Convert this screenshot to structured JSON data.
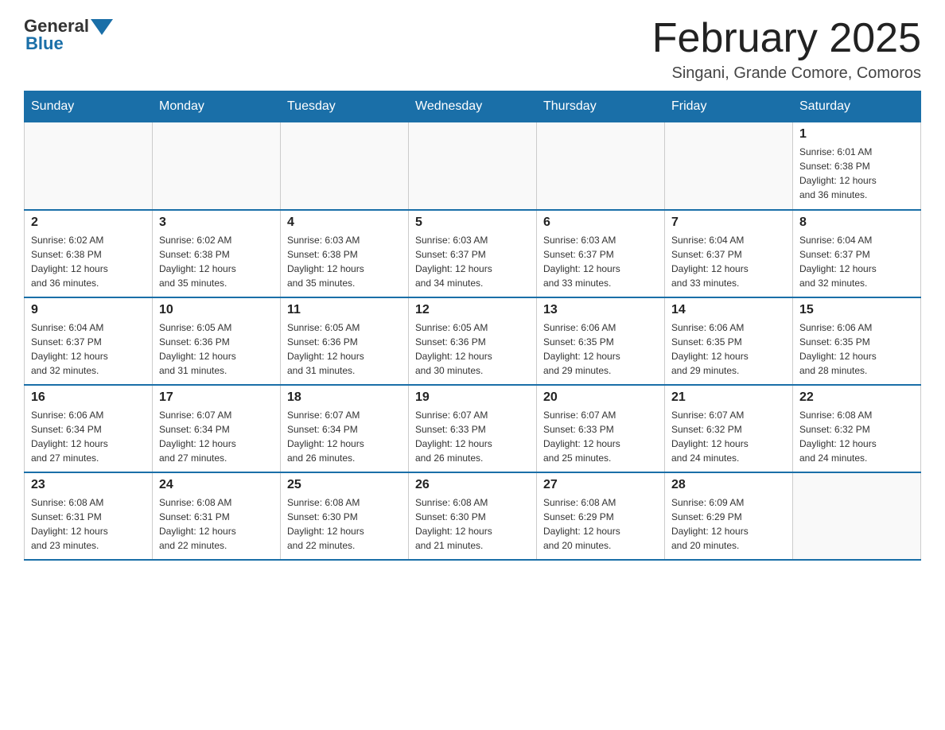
{
  "header": {
    "logo_general": "General",
    "logo_blue": "Blue",
    "title": "February 2025",
    "subtitle": "Singani, Grande Comore, Comoros"
  },
  "weekdays": [
    "Sunday",
    "Monday",
    "Tuesday",
    "Wednesday",
    "Thursday",
    "Friday",
    "Saturday"
  ],
  "weeks": [
    [
      {
        "day": "",
        "info": ""
      },
      {
        "day": "",
        "info": ""
      },
      {
        "day": "",
        "info": ""
      },
      {
        "day": "",
        "info": ""
      },
      {
        "day": "",
        "info": ""
      },
      {
        "day": "",
        "info": ""
      },
      {
        "day": "1",
        "info": "Sunrise: 6:01 AM\nSunset: 6:38 PM\nDaylight: 12 hours\nand 36 minutes."
      }
    ],
    [
      {
        "day": "2",
        "info": "Sunrise: 6:02 AM\nSunset: 6:38 PM\nDaylight: 12 hours\nand 36 minutes."
      },
      {
        "day": "3",
        "info": "Sunrise: 6:02 AM\nSunset: 6:38 PM\nDaylight: 12 hours\nand 35 minutes."
      },
      {
        "day": "4",
        "info": "Sunrise: 6:03 AM\nSunset: 6:38 PM\nDaylight: 12 hours\nand 35 minutes."
      },
      {
        "day": "5",
        "info": "Sunrise: 6:03 AM\nSunset: 6:37 PM\nDaylight: 12 hours\nand 34 minutes."
      },
      {
        "day": "6",
        "info": "Sunrise: 6:03 AM\nSunset: 6:37 PM\nDaylight: 12 hours\nand 33 minutes."
      },
      {
        "day": "7",
        "info": "Sunrise: 6:04 AM\nSunset: 6:37 PM\nDaylight: 12 hours\nand 33 minutes."
      },
      {
        "day": "8",
        "info": "Sunrise: 6:04 AM\nSunset: 6:37 PM\nDaylight: 12 hours\nand 32 minutes."
      }
    ],
    [
      {
        "day": "9",
        "info": "Sunrise: 6:04 AM\nSunset: 6:37 PM\nDaylight: 12 hours\nand 32 minutes."
      },
      {
        "day": "10",
        "info": "Sunrise: 6:05 AM\nSunset: 6:36 PM\nDaylight: 12 hours\nand 31 minutes."
      },
      {
        "day": "11",
        "info": "Sunrise: 6:05 AM\nSunset: 6:36 PM\nDaylight: 12 hours\nand 31 minutes."
      },
      {
        "day": "12",
        "info": "Sunrise: 6:05 AM\nSunset: 6:36 PM\nDaylight: 12 hours\nand 30 minutes."
      },
      {
        "day": "13",
        "info": "Sunrise: 6:06 AM\nSunset: 6:35 PM\nDaylight: 12 hours\nand 29 minutes."
      },
      {
        "day": "14",
        "info": "Sunrise: 6:06 AM\nSunset: 6:35 PM\nDaylight: 12 hours\nand 29 minutes."
      },
      {
        "day": "15",
        "info": "Sunrise: 6:06 AM\nSunset: 6:35 PM\nDaylight: 12 hours\nand 28 minutes."
      }
    ],
    [
      {
        "day": "16",
        "info": "Sunrise: 6:06 AM\nSunset: 6:34 PM\nDaylight: 12 hours\nand 27 minutes."
      },
      {
        "day": "17",
        "info": "Sunrise: 6:07 AM\nSunset: 6:34 PM\nDaylight: 12 hours\nand 27 minutes."
      },
      {
        "day": "18",
        "info": "Sunrise: 6:07 AM\nSunset: 6:34 PM\nDaylight: 12 hours\nand 26 minutes."
      },
      {
        "day": "19",
        "info": "Sunrise: 6:07 AM\nSunset: 6:33 PM\nDaylight: 12 hours\nand 26 minutes."
      },
      {
        "day": "20",
        "info": "Sunrise: 6:07 AM\nSunset: 6:33 PM\nDaylight: 12 hours\nand 25 minutes."
      },
      {
        "day": "21",
        "info": "Sunrise: 6:07 AM\nSunset: 6:32 PM\nDaylight: 12 hours\nand 24 minutes."
      },
      {
        "day": "22",
        "info": "Sunrise: 6:08 AM\nSunset: 6:32 PM\nDaylight: 12 hours\nand 24 minutes."
      }
    ],
    [
      {
        "day": "23",
        "info": "Sunrise: 6:08 AM\nSunset: 6:31 PM\nDaylight: 12 hours\nand 23 minutes."
      },
      {
        "day": "24",
        "info": "Sunrise: 6:08 AM\nSunset: 6:31 PM\nDaylight: 12 hours\nand 22 minutes."
      },
      {
        "day": "25",
        "info": "Sunrise: 6:08 AM\nSunset: 6:30 PM\nDaylight: 12 hours\nand 22 minutes."
      },
      {
        "day": "26",
        "info": "Sunrise: 6:08 AM\nSunset: 6:30 PM\nDaylight: 12 hours\nand 21 minutes."
      },
      {
        "day": "27",
        "info": "Sunrise: 6:08 AM\nSunset: 6:29 PM\nDaylight: 12 hours\nand 20 minutes."
      },
      {
        "day": "28",
        "info": "Sunrise: 6:09 AM\nSunset: 6:29 PM\nDaylight: 12 hours\nand 20 minutes."
      },
      {
        "day": "",
        "info": ""
      }
    ]
  ]
}
